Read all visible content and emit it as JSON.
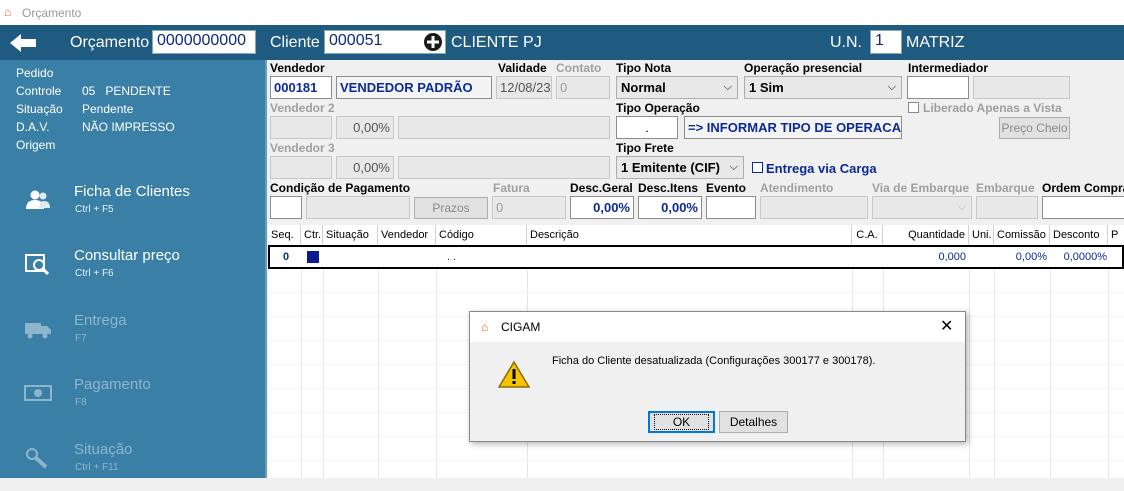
{
  "window": {
    "title": "Orçamento"
  },
  "header": {
    "back_icon": "arrow-left-icon",
    "orcamento_label": "Orçamento",
    "orcamento_value": "0000000000",
    "cliente_label": "Cliente",
    "cliente_value": "000051",
    "cliente_name": "CLIENTE PJ",
    "un_label": "U.N.",
    "un_value": "1",
    "un_name": "MATRIZ"
  },
  "sidebar": {
    "info": [
      {
        "label": "Pedido",
        "value": ""
      },
      {
        "label": "Controle",
        "value": "05   PENDENTE"
      },
      {
        "label": "Situação",
        "value": "Pendente"
      },
      {
        "label": "D.A.V.",
        "value": "NÃO IMPRESSO"
      },
      {
        "label": "Origem",
        "value": ""
      }
    ],
    "menu": [
      {
        "label": "Ficha de Clientes",
        "shortcut": "Ctrl + F5",
        "icon": "users-icon",
        "enabled": true
      },
      {
        "label": "Consultar preço",
        "shortcut": "Ctrl + F6",
        "icon": "price-search-icon",
        "enabled": true
      },
      {
        "label": "Entrega",
        "shortcut": "F7",
        "icon": "truck-icon",
        "enabled": false
      },
      {
        "label": "Pagamento",
        "shortcut": "F8",
        "icon": "money-icon",
        "enabled": false
      },
      {
        "label": "Situação",
        "shortcut": "Ctrl + F11",
        "icon": "status-icon",
        "enabled": false
      }
    ]
  },
  "form": {
    "vendedor_label": "Vendedor",
    "vendedor_code": "000181",
    "vendedor_name": "VENDEDOR PADRÃO",
    "validade_label": "Validade",
    "validade_value": "12/08/23",
    "contato_label": "Contato",
    "contato_value": "0",
    "tipo_nota_label": "Tipo Nota",
    "tipo_nota_value": "Normal",
    "operacao_presencial_label": "Operação presencial",
    "operacao_presencial_value": "1 Sim",
    "intermediador_label": "Intermediador",
    "vendedor2_label": "Vendedor 2",
    "vendedor2_pct": "0,00%",
    "tipo_operacao_label": "Tipo Operação",
    "tipo_operacao_code": ".",
    "tipo_operacao_hint": "=> INFORMAR TIPO DE OPERACA",
    "liberado_label": "Liberado Apenas a Vista",
    "preco_cheio_label": "Preço Cheio",
    "vendedor3_label": "Vendedor 3",
    "vendedor3_pct": "0,00%",
    "tipo_frete_label": "Tipo Frete",
    "tipo_frete_value": "1 Emitente (CIF)",
    "entrega_carga_label": "Entrega via Carga",
    "cond_pagamento_label": "Condição de Pagamento",
    "fatura_label": "Fatura",
    "fatura_value": "0",
    "prazos_label": "Prazos",
    "desc_geral_label": "Desc.Geral",
    "desc_geral_value": "0,00%",
    "desc_itens_label": "Desc.Itens",
    "desc_itens_value": "0,00%",
    "evento_label": "Evento",
    "atendimento_label": "Atendimento",
    "via_embarque_label": "Via de Embarque",
    "embarque_label": "Embarque",
    "ordem_compra_label": "Ordem Compra"
  },
  "grid": {
    "columns": [
      "Seq.",
      "Ctr.",
      "Situação",
      "Vendedor",
      "Código",
      "Descrição",
      "C.A.",
      "Quantidade",
      "Uni.",
      "Comissão",
      "Desconto",
      "P"
    ],
    "row": {
      "seq": "0",
      "codigo": ". .",
      "quantidade": "0,000",
      "comissao": "0,00%",
      "desconto": "0,0000%"
    }
  },
  "dialog": {
    "title": "CIGAM",
    "message": "Ficha do Cliente desatualizada (Configurações 300177 e 300178).",
    "ok_label": "OK",
    "details_label": "Detalhes",
    "warning_icon": "warning-icon"
  }
}
